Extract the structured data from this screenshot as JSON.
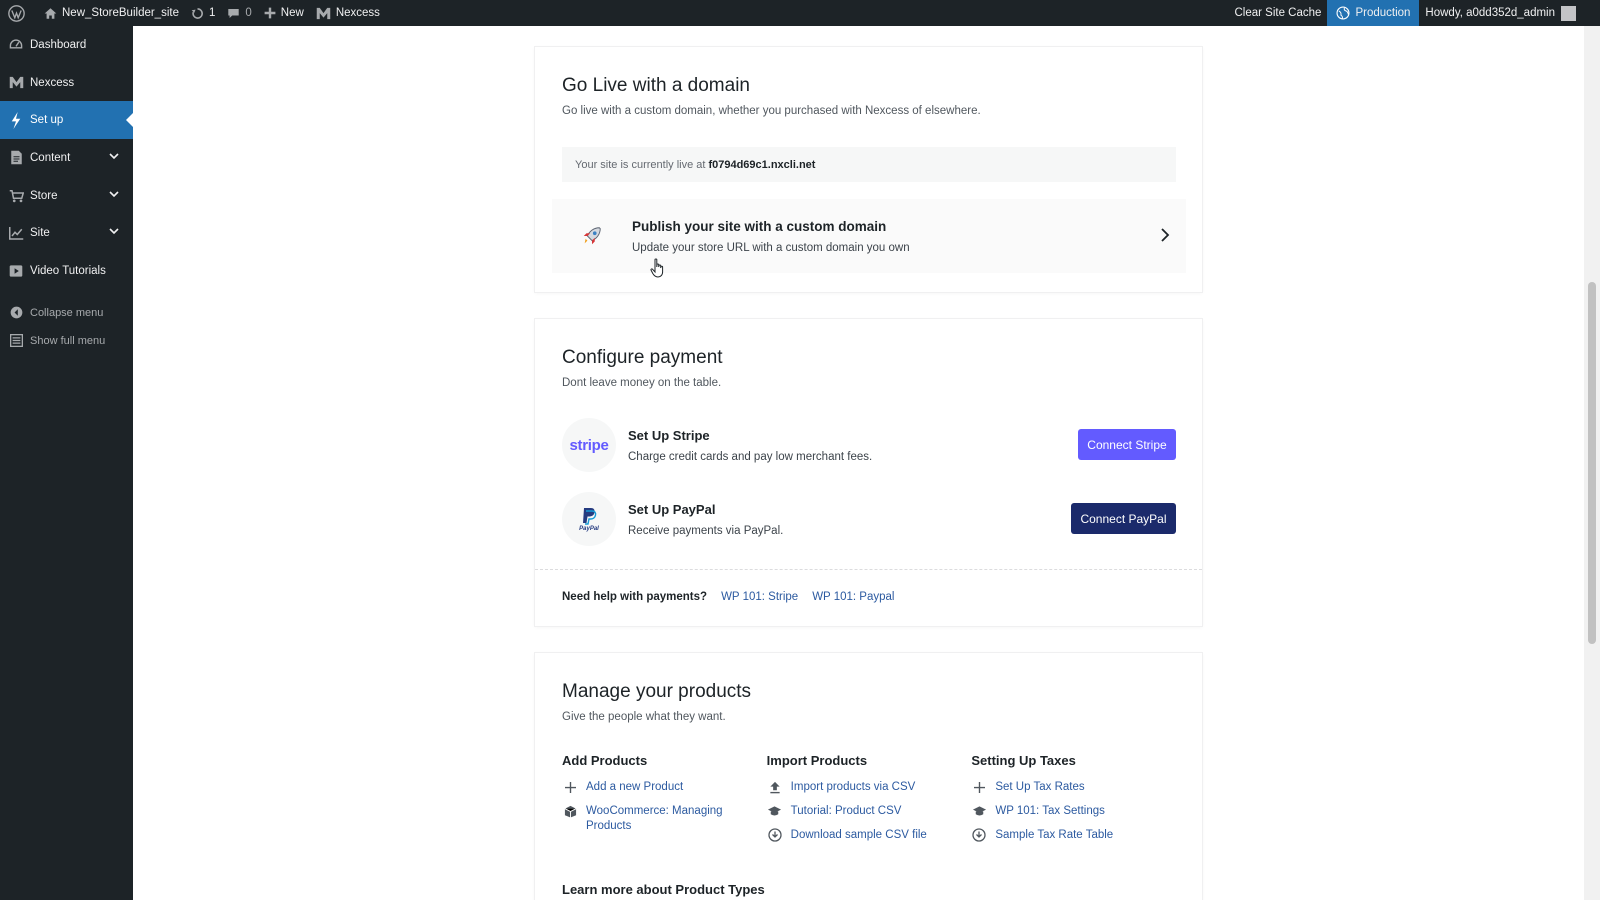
{
  "adminbar": {
    "site_name": "New_StoreBuilder_site",
    "updates_count": "1",
    "comments_count": "0",
    "new_label": "New",
    "nexcess_label": "Nexcess",
    "clear_cache_label": "Clear Site Cache",
    "environment_label": "Production",
    "howdy_label": "Howdy, a0dd352d_admin"
  },
  "sidebar": {
    "items": [
      {
        "label": "Dashboard"
      },
      {
        "label": "Nexcess"
      },
      {
        "label": "Set up"
      },
      {
        "label": "Content"
      },
      {
        "label": "Store"
      },
      {
        "label": "Site"
      },
      {
        "label": "Video Tutorials"
      }
    ],
    "collapse_label": "Collapse menu",
    "full_menu_label": "Show full menu"
  },
  "domain_card": {
    "title": "Go Live with a domain",
    "subtitle": "Go live with a custom domain, whether you purchased with Nexcess of elsewhere.",
    "live_prefix": "Your site is currently live at",
    "live_url": "f0794d69c1.nxcli.net",
    "publish_title": "Publish your site with a custom domain",
    "publish_subtitle": "Update your store URL with a custom domain you own"
  },
  "payment_card": {
    "title": "Configure payment",
    "subtitle": "Dont leave money on the table.",
    "stripe_logo_text": "stripe",
    "stripe_title": "Set Up Stripe",
    "stripe_subtitle": "Charge credit cards and pay low merchant fees.",
    "stripe_button": "Connect Stripe",
    "paypal_logo_text": "PayPal",
    "paypal_title": "Set Up PayPal",
    "paypal_subtitle": "Receive payments via PayPal.",
    "paypal_button": "Connect PayPal",
    "help_label": "Need help with payments?",
    "help_link_stripe": "WP 101: Stripe",
    "help_link_paypal": "WP 101: Paypal"
  },
  "products_card": {
    "title": "Manage your products",
    "subtitle": "Give the people what they want.",
    "columns": [
      {
        "heading": "Add Products",
        "links": [
          {
            "label": "Add a new Product",
            "icon": "plus-icon"
          },
          {
            "label": "WooCommerce: Managing Products",
            "icon": "box-icon"
          }
        ]
      },
      {
        "heading": "Import Products",
        "links": [
          {
            "label": "Import products via CSV",
            "icon": "upload-icon"
          },
          {
            "label": "Tutorial: Product CSV",
            "icon": "graduation-cap-icon"
          },
          {
            "label": "Download sample CSV file",
            "icon": "download-icon"
          }
        ]
      },
      {
        "heading": "Setting Up Taxes",
        "links": [
          {
            "label": "Set Up Tax Rates",
            "icon": "plus-icon"
          },
          {
            "label": "WP 101: Tax Settings",
            "icon": "graduation-cap-icon"
          },
          {
            "label": "Sample Tax Rate Table",
            "icon": "download-icon"
          }
        ]
      }
    ],
    "learn_more": "Learn more about Product Types"
  }
}
